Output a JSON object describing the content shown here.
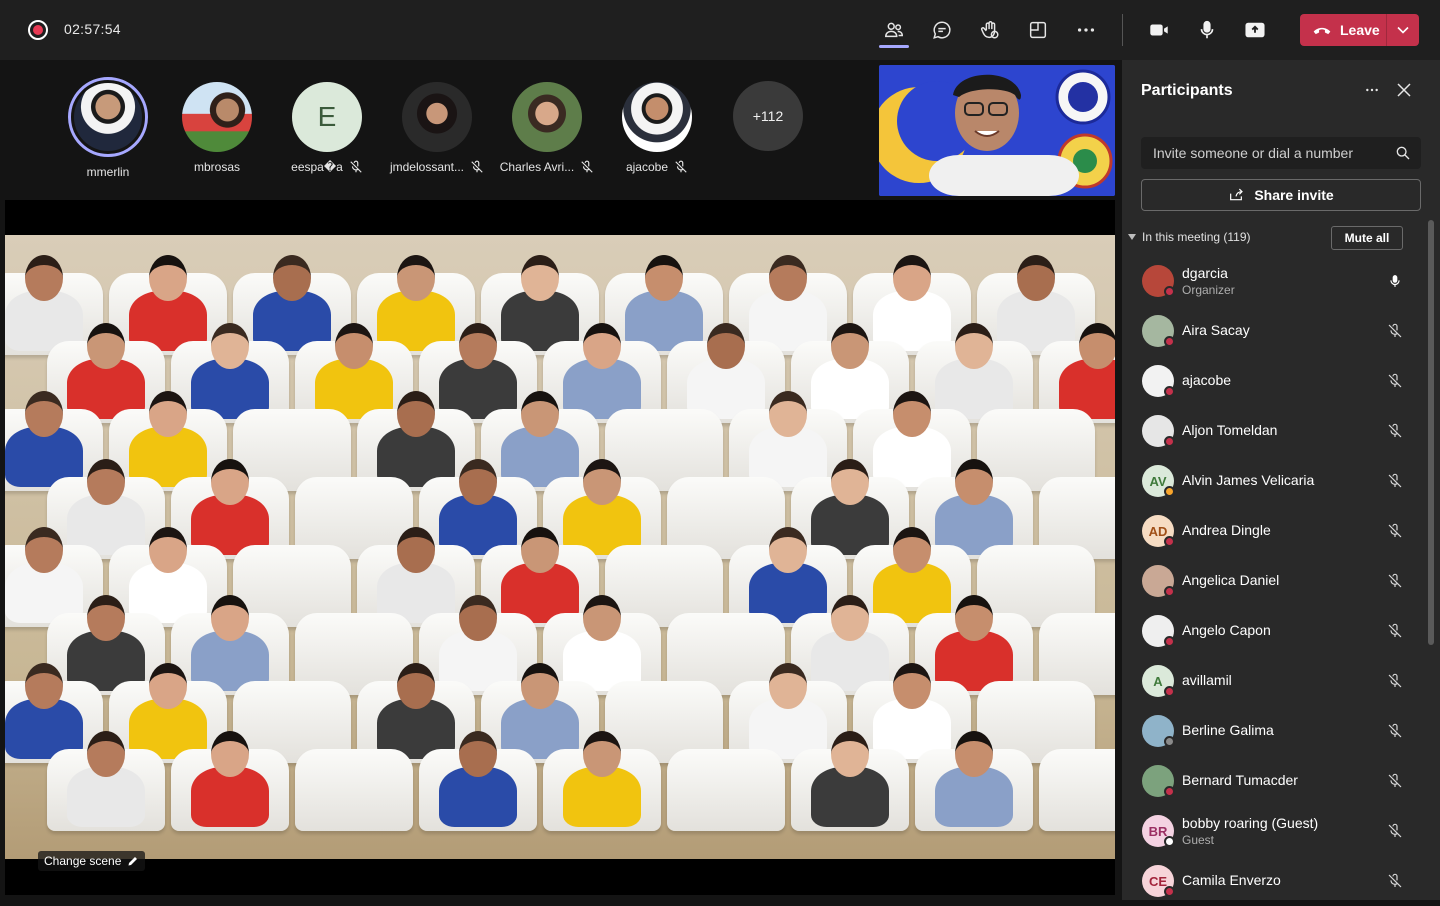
{
  "header": {
    "recording_icon": "record-icon",
    "timer": "02:57:54",
    "leave_label": "Leave",
    "accent": "#a6a8ff",
    "leave_color": "#c4314b"
  },
  "toolbar_icons": [
    "people-icon",
    "chat-icon",
    "raise-hand-icon",
    "rooms-icon",
    "more-icon",
    "camera-icon",
    "mic-icon",
    "share-screen-icon"
  ],
  "stage": {
    "participants": [
      {
        "name": "mmerlin",
        "muted": false,
        "speaking": true
      },
      {
        "name": "mbrosas",
        "muted": false,
        "speaking": false
      },
      {
        "name": "eespa�a",
        "initial": "E",
        "muted": true,
        "speaking": false
      },
      {
        "name": "jmdelossant...",
        "muted": true,
        "speaking": false
      },
      {
        "name": "Charles Avri...",
        "muted": true,
        "speaking": false
      },
      {
        "name": "ajacobe",
        "muted": true,
        "speaking": false
      }
    ],
    "overflow_count": "+112",
    "change_scene_label": "Change scene"
  },
  "panel": {
    "title": "Participants",
    "invite_placeholder": "Invite someone or dial a number",
    "share_invite_label": "Share invite",
    "section_label": "In this meeting (119)",
    "mute_all_label": "Mute all",
    "people": [
      {
        "name": "dgarcia",
        "role": "Organizer",
        "initials": "",
        "avatar_color": "#b7473a",
        "status": "#c4314b",
        "mic": "on"
      },
      {
        "name": "Aira Sacay",
        "role": "",
        "initials": "",
        "avatar_color": "#a5b7a0",
        "status": "#c4314b",
        "mic": "off"
      },
      {
        "name": "ajacobe",
        "role": "",
        "initials": "",
        "avatar_color": "#f2f2f2",
        "status": "#c4314b",
        "mic": "off"
      },
      {
        "name": "Aljon Tomeldan",
        "role": "",
        "initials": "",
        "avatar_color": "#e6e6e6",
        "status": "#c4314b",
        "mic": "off"
      },
      {
        "name": "Alvin James Velicaria",
        "role": "",
        "initials": "AV",
        "avatar_color": "#dbe9da",
        "initials_color": "#3f7a3b",
        "status": "#f8a52c",
        "mic": "off"
      },
      {
        "name": "Andrea Dingle",
        "role": "",
        "initials": "AD",
        "avatar_color": "#f6dcc3",
        "initials_color": "#a04f17",
        "status": "#c4314b",
        "mic": "off"
      },
      {
        "name": "Angelica Daniel",
        "role": "",
        "initials": "",
        "avatar_color": "#c9a895",
        "status": "#c4314b",
        "mic": "off"
      },
      {
        "name": "Angelo Capon",
        "role": "",
        "initials": "",
        "avatar_color": "#efefef",
        "status": "#c4314b",
        "mic": "off"
      },
      {
        "name": "avillamil",
        "role": "",
        "initials": "A",
        "avatar_color": "#dbe9da",
        "initials_color": "#3f7a3b",
        "status": "#c4314b",
        "mic": "off"
      },
      {
        "name": "Berline Galima",
        "role": "",
        "initials": "",
        "avatar_color": "#8fb3c9",
        "status": "#8a8a8a",
        "mic": "off"
      },
      {
        "name": "Bernard Tumacder",
        "role": "",
        "initials": "",
        "avatar_color": "#7ca27d",
        "status": "#c4314b",
        "mic": "off"
      },
      {
        "name": "bobby roaring (Guest)",
        "role": "Guest",
        "initials": "BR",
        "avatar_color": "#f4d2e2",
        "initials_color": "#9b2f63",
        "status": "#ffffff",
        "mic": "off"
      },
      {
        "name": "Camila Enverzo",
        "role": "",
        "initials": "CE",
        "avatar_color": "#f7d4d9",
        "initials_color": "#a3243b",
        "status": "#c4314b",
        "mic": "off"
      }
    ]
  }
}
